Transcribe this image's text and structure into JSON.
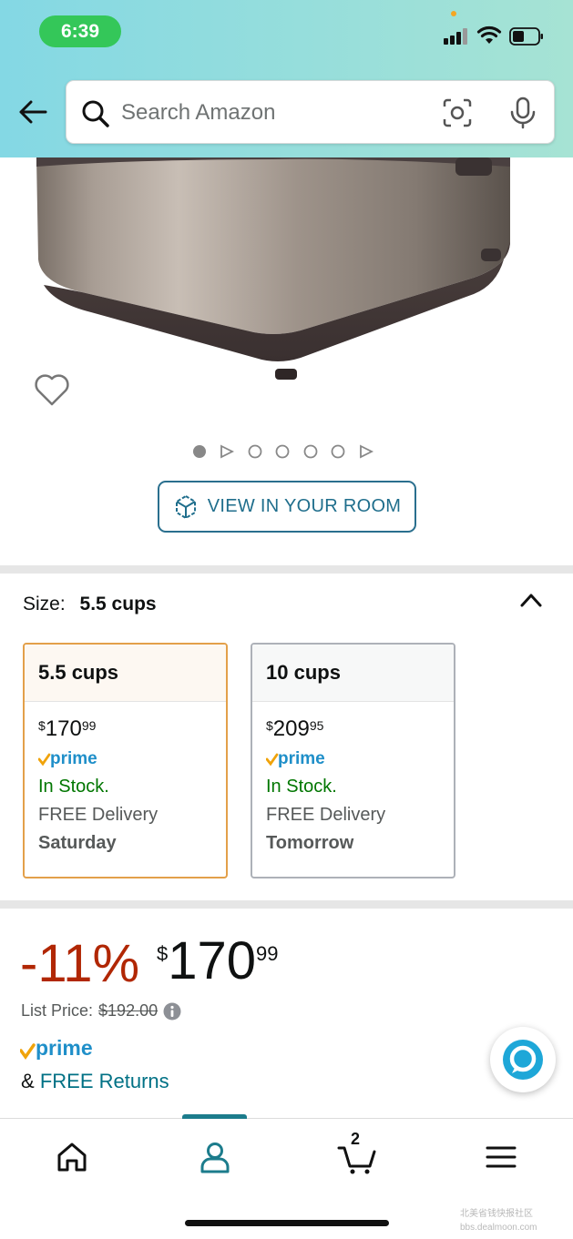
{
  "status_bar": {
    "time": "6:39"
  },
  "search": {
    "placeholder": "Search Amazon"
  },
  "view_in_room": {
    "label": "VIEW IN YOUR ROOM"
  },
  "size": {
    "label": "Size:",
    "selected": "5.5 cups",
    "options": [
      {
        "name": "5.5 cups",
        "price_whole": "170",
        "price_cents": "99",
        "currency": "$",
        "stock": "In Stock.",
        "delivery": "FREE Delivery",
        "day": "Saturday",
        "selected": true
      },
      {
        "name": "10 cups",
        "price_whole": "209",
        "price_cents": "95",
        "currency": "$",
        "stock": "In Stock.",
        "delivery": "FREE Delivery",
        "day": "Tomorrow",
        "selected": false
      }
    ]
  },
  "pricing": {
    "discount": "-11%",
    "currency": "$",
    "price_whole": "170",
    "price_cents": "99",
    "list_price_label": "List Price:",
    "list_price": "$192.00",
    "returns_prefix": "&",
    "returns_link": "FREE Returns"
  },
  "prime": {
    "label": "prime"
  },
  "cart": {
    "count": "2"
  },
  "watermark": {
    "line1": "北美省钱快报社区",
    "line2": "bbs.dealmoon.com"
  },
  "colors": {
    "accent": "#007185",
    "discount": "#b12704",
    "in_stock": "#007600",
    "selected_border": "#e3a04a",
    "prime_check": "#f0a30a",
    "prime_text": "#1f8fc9"
  },
  "image_carousel": {
    "count": 7,
    "active_index": 0
  }
}
